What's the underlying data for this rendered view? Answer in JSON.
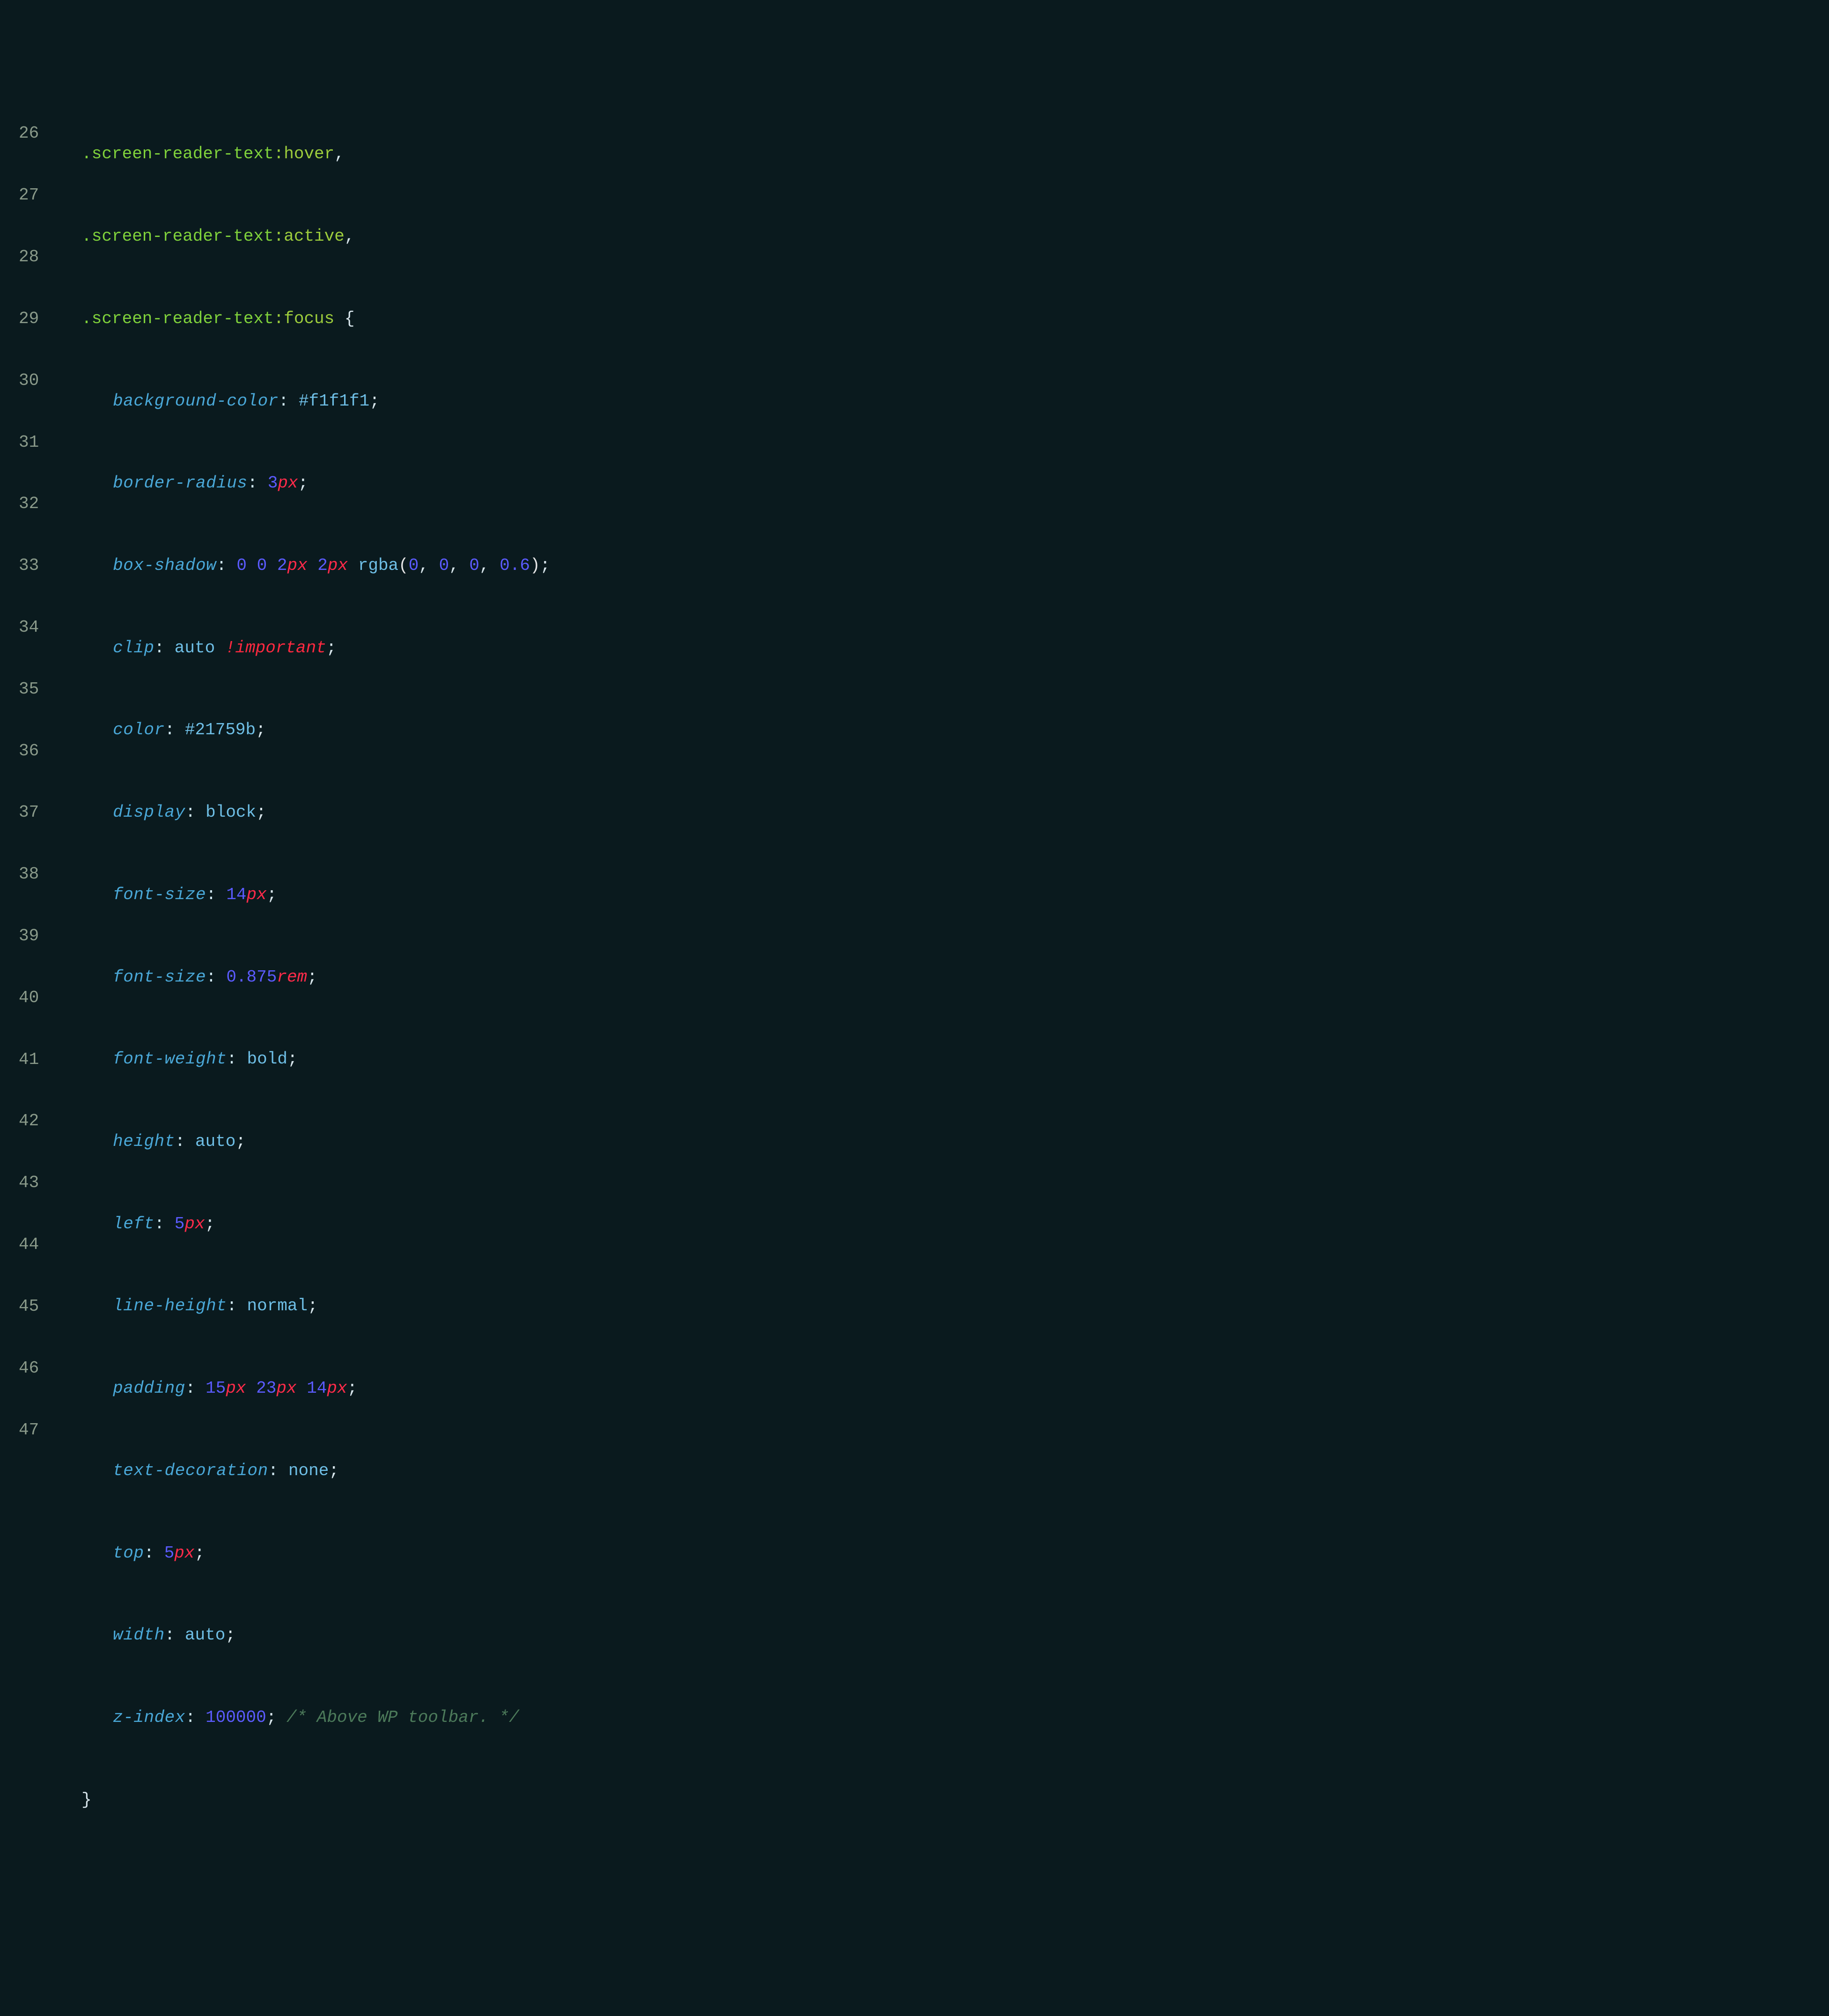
{
  "theme": {
    "bg": "#0a1a1e",
    "gutter": "#8a9a8a",
    "selector": "#7fd13b",
    "property": "#4aa8d8",
    "value": "#6fbfe6",
    "number": "#5b5bff",
    "unit": "#ff2b4a",
    "important": "#ff2940",
    "comment": "#4c7a5a",
    "punct": "#d8e6ec"
  },
  "line_numbers": [
    "26",
    "27",
    "28",
    "29",
    "30",
    "31",
    "32",
    "33",
    "34",
    "35",
    "36",
    "37",
    "38",
    "39",
    "40",
    "41",
    "42",
    "43",
    "44",
    "45",
    "46",
    "47"
  ],
  "sel_26_class": ".screen-reader-text",
  "sel_26_pseudo": ":hover",
  "sel_26_comma": ",",
  "sel_27_class": ".screen-reader-text",
  "sel_27_pseudo": ":active",
  "sel_27_comma": ",",
  "sel_28_class": ".screen-reader-text",
  "sel_28_pseudo": ":focus",
  "sel_28_brace": " {",
  "p29": "background-color",
  "v29_hex": "#f1f1f1",
  "p30": "border-radius",
  "v30_num": "3",
  "v30_unit": "px",
  "p31": "box-shadow",
  "v31_n1": "0",
  "v31_n2": "0",
  "v31_n3": "2",
  "v31_u3": "px",
  "v31_n4": "2",
  "v31_u4": "px",
  "v31_func": "rgba",
  "v31_a1": "0",
  "v31_a2": "0",
  "v31_a3": "0",
  "v31_a4": "0.6",
  "p32": "clip",
  "v32_val": "auto",
  "v32_imp": "!important",
  "p33": "color",
  "v33_hex": "#21759b",
  "p34": "display",
  "v34_val": "block",
  "p35": "font-size",
  "v35_num": "14",
  "v35_unit": "px",
  "p36": "font-size",
  "v36_num": "0.875",
  "v36_unit": "rem",
  "p37": "font-weight",
  "v37_val": "bold",
  "p38": "height",
  "v38_val": "auto",
  "p39": "left",
  "v39_num": "5",
  "v39_unit": "px",
  "p40": "line-height",
  "v40_val": "normal",
  "p41": "padding",
  "v41_n1": "15",
  "v41_u1": "px",
  "v41_n2": "23",
  "v41_u2": "px",
  "v41_n3": "14",
  "v41_u3": "px",
  "p42": "text-decoration",
  "v42_val": "none",
  "p43": "top",
  "v43_num": "5",
  "v43_unit": "px",
  "p44": "width",
  "v44_val": "auto",
  "p45": "z-index",
  "v45_num": "100000",
  "c45": "/* Above WP toolbar. */",
  "close_brace": "}",
  "colon": ":",
  "semi": ";",
  "comma": ", ",
  "paren_open": "(",
  "paren_close": ")",
  "sp": " "
}
